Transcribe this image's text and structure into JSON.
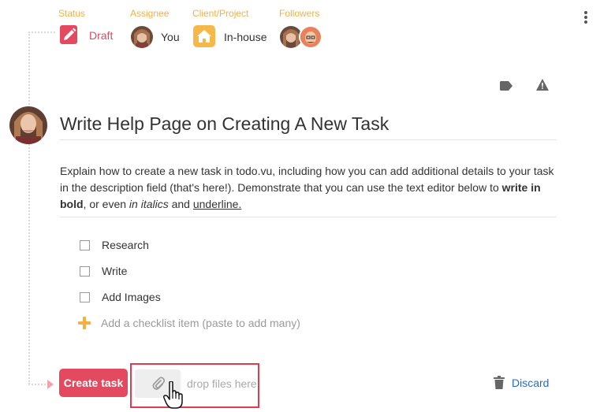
{
  "meta": {
    "status": {
      "label": "Status",
      "value": "Draft",
      "icon": "pencil-icon"
    },
    "assignee": {
      "label": "Assignee",
      "value": "You"
    },
    "client": {
      "label": "Client/Project",
      "value": "In-house",
      "icon": "home-icon"
    },
    "followers": {
      "label": "Followers"
    }
  },
  "task": {
    "title": "Write Help Page on Creating A New Task",
    "description": {
      "part1": "Explain how to create a new task in todo.vu, including how you can add additional details to your task in the description field (that's here!). Demonstrate that you can use the text editor below to ",
      "bold": "write in bold",
      "part2": ", or even ",
      "italic": "in italics",
      "part3": " and ",
      "underline": "underline."
    }
  },
  "checklist": {
    "items": [
      {
        "label": "Research",
        "checked": false
      },
      {
        "label": "Write",
        "checked": false
      },
      {
        "label": "Add Images",
        "checked": false
      }
    ],
    "add_placeholder": "Add a checklist item (paste to add many)"
  },
  "footer": {
    "create_label": "Create task",
    "drop_text": "drop files here",
    "discard_label": "Discard"
  },
  "colors": {
    "accent": "#e34a5f",
    "highlight": "#f5b041",
    "link": "#2a6bbf"
  }
}
